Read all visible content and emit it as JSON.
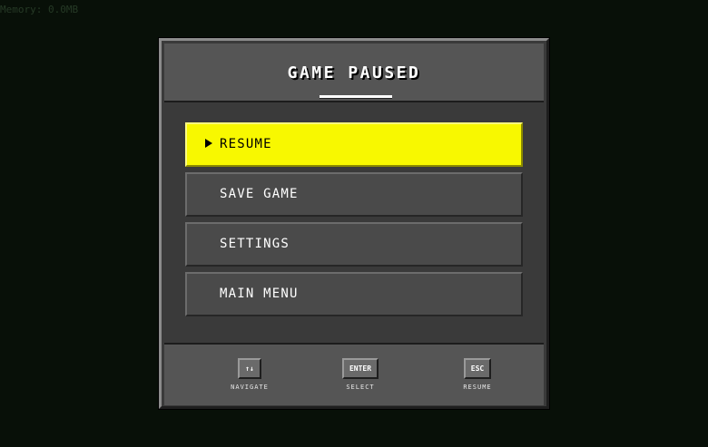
{
  "memory_readout": "Memory: 0.0MB",
  "pause_menu": {
    "title": "GAME PAUSED",
    "items": [
      {
        "label": "RESUME",
        "selected": true
      },
      {
        "label": "SAVE GAME",
        "selected": false
      },
      {
        "label": "SETTINGS",
        "selected": false
      },
      {
        "label": "MAIN MENU",
        "selected": false
      }
    ]
  },
  "controls": [
    {
      "key": "↑↓",
      "action": "NAVIGATE"
    },
    {
      "key": "ENTER",
      "action": "SELECT"
    },
    {
      "key": "ESC",
      "action": "RESUME"
    }
  ],
  "colors": {
    "background": "#081008",
    "selected_item": "#f8f800",
    "panel": "#3a3a3a"
  }
}
